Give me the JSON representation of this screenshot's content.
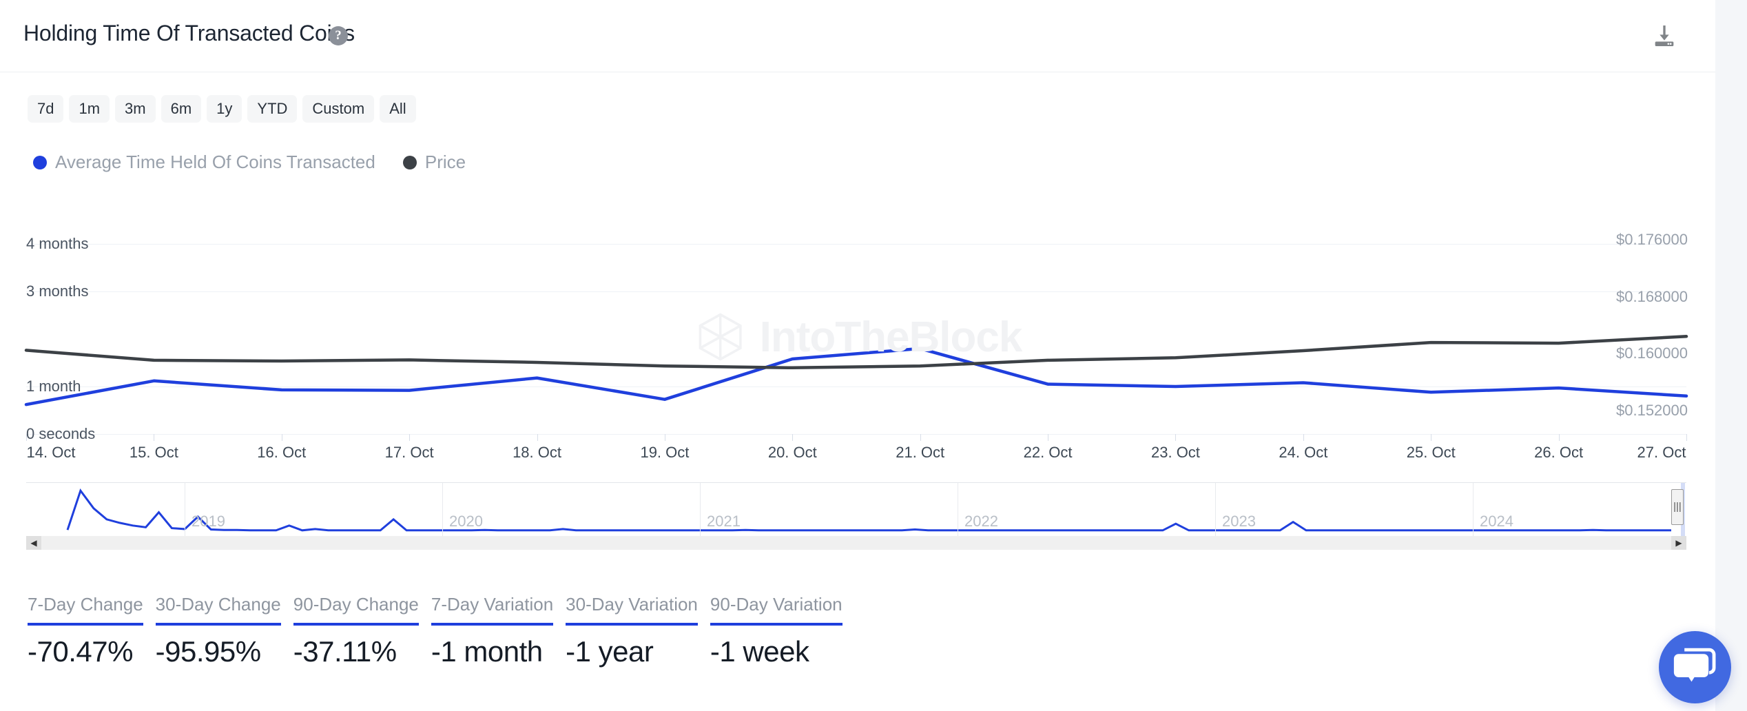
{
  "header": {
    "title": "Holding Time Of Transacted Coins",
    "help_icon": "question-mark-icon",
    "download_icon": "download-icon"
  },
  "ranges": {
    "buttons": [
      {
        "label": "7d"
      },
      {
        "label": "1m"
      },
      {
        "label": "3m"
      },
      {
        "label": "6m"
      },
      {
        "label": "1y"
      },
      {
        "label": "YTD"
      },
      {
        "label": "Custom"
      },
      {
        "label": "All"
      }
    ]
  },
  "legend": {
    "items": [
      {
        "label": "Average Time Held Of Coins Transacted",
        "color": "#1f3fdd"
      },
      {
        "label": "Price",
        "color": "#3c4146"
      }
    ]
  },
  "watermark": {
    "text": "IntoTheBlock"
  },
  "navigator": {
    "years": [
      "2019",
      "2020",
      "2021",
      "2022",
      "2023",
      "2024"
    ],
    "left_arrow": "◀",
    "right_arrow": "▶",
    "handle_icon": "|||"
  },
  "stats": [
    {
      "label": "7-Day Change",
      "value": "-70.47%"
    },
    {
      "label": "30-Day Change",
      "value": "-95.95%"
    },
    {
      "label": "90-Day Change",
      "value": "-37.11%"
    },
    {
      "label": "7-Day Variation",
      "value": "-1 month"
    },
    {
      "label": "30-Day Variation",
      "value": "-1 year"
    },
    {
      "label": "90-Day Variation",
      "value": "-1 week"
    }
  ],
  "chat": {
    "icon": "chat-bubbles-icon"
  },
  "chart_data": {
    "type": "line",
    "title": "Holding Time Of Transacted Coins",
    "xlabel": "",
    "ylabel": "Average Time Held Of Coins Transacted",
    "y2label": "Price",
    "grid": true,
    "legend_position": "top-left",
    "categories": [
      "14. Oct",
      "15. Oct",
      "16. Oct",
      "17. Oct",
      "18. Oct",
      "19. Oct",
      "20. Oct",
      "21. Oct",
      "22. Oct",
      "23. Oct",
      "24. Oct",
      "25. Oct",
      "26. Oct",
      "27. Oct"
    ],
    "yticks_left": [
      "0 seconds",
      "1 month",
      "3 months",
      "4 months"
    ],
    "yticks_left_values": [
      0,
      1,
      3,
      4
    ],
    "ylim_left": [
      0,
      4.35
    ],
    "yticks_right": [
      "$0.152000",
      "$0.160000",
      "$0.168000",
      "$0.176000"
    ],
    "yticks_right_values": [
      0.152,
      0.16,
      0.168,
      0.176
    ],
    "ylim_right": [
      0.1495,
      0.1785
    ],
    "series": [
      {
        "name": "Average Time Held Of Coins Transacted",
        "color": "#1f3fdd",
        "axis": "left",
        "unit": "months",
        "values": [
          0.62,
          1.12,
          0.93,
          0.92,
          1.18,
          0.73,
          1.58,
          1.8,
          1.05,
          1.0,
          1.08,
          0.88,
          0.97,
          0.8
        ]
      },
      {
        "name": "Price",
        "color": "#3c4146",
        "axis": "right",
        "unit": "USD",
        "values": [
          0.16125,
          0.15985,
          0.15975,
          0.1599,
          0.15955,
          0.15905,
          0.1588,
          0.15905,
          0.15985,
          0.1602,
          0.1612,
          0.16235,
          0.16225,
          0.1632
        ]
      }
    ],
    "navigator_series": {
      "name": "Average Time Held Of Coins Transacted",
      "color": "#1f3fdd",
      "x": [
        "2019",
        "2020",
        "2021",
        "2022",
        "2023",
        "2024"
      ]
    }
  }
}
